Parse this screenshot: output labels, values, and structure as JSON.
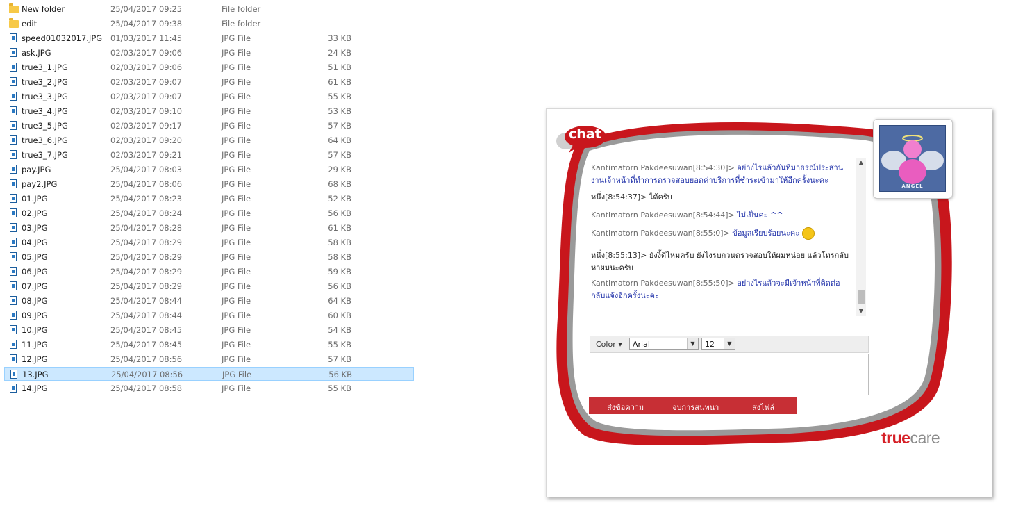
{
  "files": [
    {
      "name": "New folder",
      "date": "25/04/2017 09:25",
      "type": "File folder",
      "size": "",
      "kind": "folder"
    },
    {
      "name": "edit",
      "date": "25/04/2017 09:38",
      "type": "File folder",
      "size": "",
      "kind": "folder"
    },
    {
      "name": "speed01032017.JPG",
      "date": "01/03/2017 11:45",
      "type": "JPG File",
      "size": "33 KB",
      "kind": "jpg"
    },
    {
      "name": "ask.JPG",
      "date": "02/03/2017 09:06",
      "type": "JPG File",
      "size": "24 KB",
      "kind": "jpg"
    },
    {
      "name": "true3_1.JPG",
      "date": "02/03/2017 09:06",
      "type": "JPG File",
      "size": "51 KB",
      "kind": "jpg"
    },
    {
      "name": "true3_2.JPG",
      "date": "02/03/2017 09:07",
      "type": "JPG File",
      "size": "61 KB",
      "kind": "jpg"
    },
    {
      "name": "true3_3.JPG",
      "date": "02/03/2017 09:07",
      "type": "JPG File",
      "size": "55 KB",
      "kind": "jpg"
    },
    {
      "name": "true3_4.JPG",
      "date": "02/03/2017 09:10",
      "type": "JPG File",
      "size": "53 KB",
      "kind": "jpg"
    },
    {
      "name": "true3_5.JPG",
      "date": "02/03/2017 09:17",
      "type": "JPG File",
      "size": "57 KB",
      "kind": "jpg"
    },
    {
      "name": "true3_6.JPG",
      "date": "02/03/2017 09:20",
      "type": "JPG File",
      "size": "64 KB",
      "kind": "jpg"
    },
    {
      "name": "true3_7.JPG",
      "date": "02/03/2017 09:21",
      "type": "JPG File",
      "size": "57 KB",
      "kind": "jpg"
    },
    {
      "name": "pay.JPG",
      "date": "25/04/2017 08:03",
      "type": "JPG File",
      "size": "29 KB",
      "kind": "jpg"
    },
    {
      "name": "pay2.JPG",
      "date": "25/04/2017 08:06",
      "type": "JPG File",
      "size": "68 KB",
      "kind": "jpg"
    },
    {
      "name": "01.JPG",
      "date": "25/04/2017 08:23",
      "type": "JPG File",
      "size": "52 KB",
      "kind": "jpg"
    },
    {
      "name": "02.JPG",
      "date": "25/04/2017 08:24",
      "type": "JPG File",
      "size": "56 KB",
      "kind": "jpg"
    },
    {
      "name": "03.JPG",
      "date": "25/04/2017 08:28",
      "type": "JPG File",
      "size": "61 KB",
      "kind": "jpg"
    },
    {
      "name": "04.JPG",
      "date": "25/04/2017 08:29",
      "type": "JPG File",
      "size": "58 KB",
      "kind": "jpg"
    },
    {
      "name": "05.JPG",
      "date": "25/04/2017 08:29",
      "type": "JPG File",
      "size": "58 KB",
      "kind": "jpg"
    },
    {
      "name": "06.JPG",
      "date": "25/04/2017 08:29",
      "type": "JPG File",
      "size": "59 KB",
      "kind": "jpg"
    },
    {
      "name": "07.JPG",
      "date": "25/04/2017 08:29",
      "type": "JPG File",
      "size": "56 KB",
      "kind": "jpg"
    },
    {
      "name": "08.JPG",
      "date": "25/04/2017 08:44",
      "type": "JPG File",
      "size": "64 KB",
      "kind": "jpg"
    },
    {
      "name": "09.JPG",
      "date": "25/04/2017 08:44",
      "type": "JPG File",
      "size": "60 KB",
      "kind": "jpg"
    },
    {
      "name": "10.JPG",
      "date": "25/04/2017 08:45",
      "type": "JPG File",
      "size": "54 KB",
      "kind": "jpg"
    },
    {
      "name": "11.JPG",
      "date": "25/04/2017 08:45",
      "type": "JPG File",
      "size": "55 KB",
      "kind": "jpg"
    },
    {
      "name": "12.JPG",
      "date": "25/04/2017 08:56",
      "type": "JPG File",
      "size": "57 KB",
      "kind": "jpg"
    },
    {
      "name": "13.JPG",
      "date": "25/04/2017 08:56",
      "type": "JPG File",
      "size": "56 KB",
      "kind": "jpg",
      "selected": true
    },
    {
      "name": "14.JPG",
      "date": "25/04/2017 08:58",
      "type": "JPG File",
      "size": "55 KB",
      "kind": "jpg"
    }
  ],
  "chat": {
    "logo": "chat",
    "avatar_caption": "ANGEL",
    "messages": [
      {
        "who": "Kantimatorn Pakdeesuwan[8:54:30]>",
        "text": "อย่างไรแล้วกันทิมาธรณ์ประสานงานเจ้าหน้าที่ทำการตรวจสอบยอดค่าบริการที่ชำระเข้ามาให้อีกครั้งนะคะ",
        "agent": true
      },
      {
        "who": "หนึ่ง[8:54:37]>",
        "text": "ได้ครับ",
        "agent": false
      },
      {
        "who": "Kantimatorn Pakdeesuwan[8:54:44]>",
        "text": "ไม่เป็นค่ะ ^^",
        "agent": true
      },
      {
        "who": "Kantimatorn Pakdeesuwan[8:55:0]>",
        "text": "ข้อมูลเรียบร้อยนะคะ",
        "agent": true,
        "smiley": true
      },
      {
        "who": "หนึ่ง[8:55:13]>",
        "text": "ยังงี้ดีไหมครับ ยังไงรบกวนตรวจสอบให้ผมหน่อย แล้วโทรกลับหาผมนะครับ",
        "agent": false
      },
      {
        "who": "Kantimatorn Pakdeesuwan[8:55:50]>",
        "text": "อย่างไรแล้วจะมีเจ้าหน้าที่ติดต่อกลับแจ้งอีกครั้งนะคะ",
        "agent": true
      }
    ],
    "toolbar": {
      "color_label": "Color ▾",
      "font": "Arial",
      "size": "12"
    },
    "actions": {
      "send": "ส่งข้อความ",
      "end": "จบการสนทนา",
      "file": "ส่งไฟล์"
    },
    "brand": {
      "true": "true",
      "care": "care"
    }
  },
  "colors": {
    "brand_red": "#d51f26",
    "selection": "#cce8ff",
    "agent_text": "#2233aa"
  }
}
